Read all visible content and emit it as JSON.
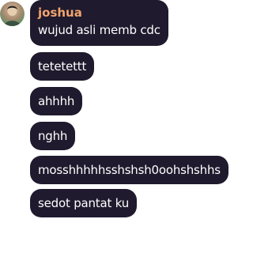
{
  "sender": {
    "name": "joshua",
    "name_color": "#f2a46e",
    "avatar_icon": "user-avatar"
  },
  "bubble_color": "#1f1a2d",
  "messages": [
    "wujud asli memb cdc",
    "tetetettt",
    "ahhhh",
    "nghh",
    "mosshhhhhsshshsh0oohshshhs",
    "sedot pantat ku"
  ]
}
